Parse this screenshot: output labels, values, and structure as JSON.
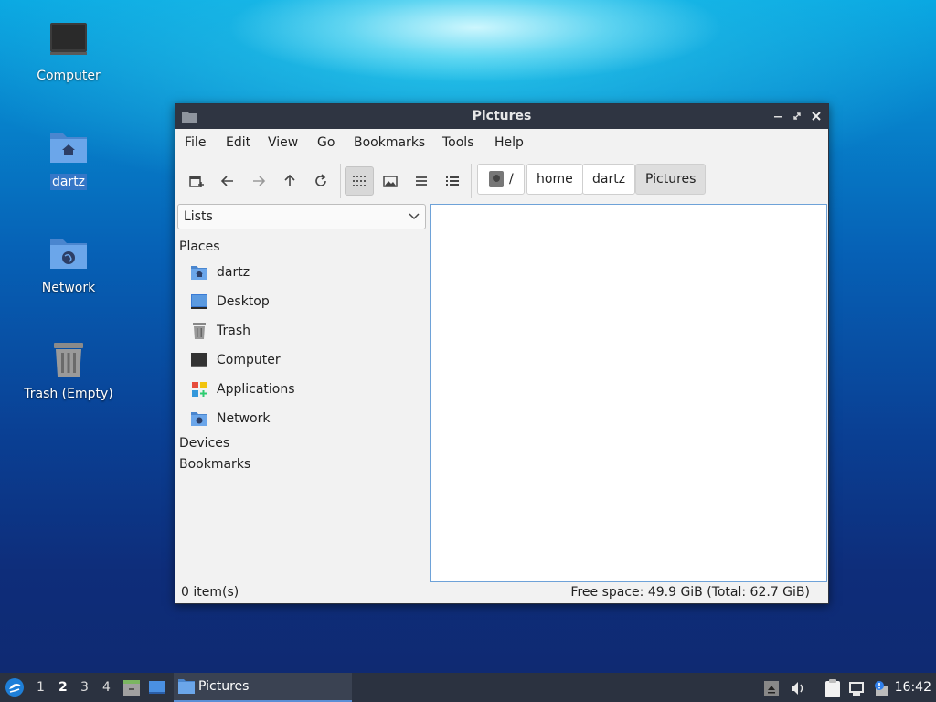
{
  "desktop": {
    "icons": [
      {
        "label": "Computer"
      },
      {
        "label": "dartz"
      },
      {
        "label": "Network"
      },
      {
        "label": "Trash (Empty)"
      }
    ]
  },
  "window": {
    "title": "Pictures",
    "menu": [
      "File",
      "Edit",
      "View",
      "Go",
      "Bookmarks",
      "Tools",
      "Help"
    ],
    "path": {
      "root": "/",
      "crumbs": [
        "home",
        "dartz",
        "Pictures"
      ]
    },
    "sidebar": {
      "selector": "Lists",
      "sections": {
        "places": "Places",
        "devices": "Devices",
        "bookmarks": "Bookmarks"
      },
      "places": [
        {
          "label": "dartz",
          "icon": "home-folder-icon"
        },
        {
          "label": "Desktop",
          "icon": "desktop-icon"
        },
        {
          "label": "Trash",
          "icon": "trash-icon"
        },
        {
          "label": "Computer",
          "icon": "computer-icon"
        },
        {
          "label": "Applications",
          "icon": "applications-icon"
        },
        {
          "label": "Network",
          "icon": "network-folder-icon"
        }
      ]
    },
    "status": {
      "items": "0 item(s)",
      "free_space": "Free space: 49.9 GiB (Total: 62.7 GiB)"
    }
  },
  "taskbar": {
    "workspaces": [
      "1",
      "2",
      "3",
      "4"
    ],
    "active_workspace": "2",
    "task_label": "Pictures",
    "clock": "16:42"
  },
  "colors": {
    "accent": "#5b8fd6",
    "titlebar": "#2f3542",
    "taskbar": "#2b3240",
    "folder_blue": "#5b9ae0"
  }
}
